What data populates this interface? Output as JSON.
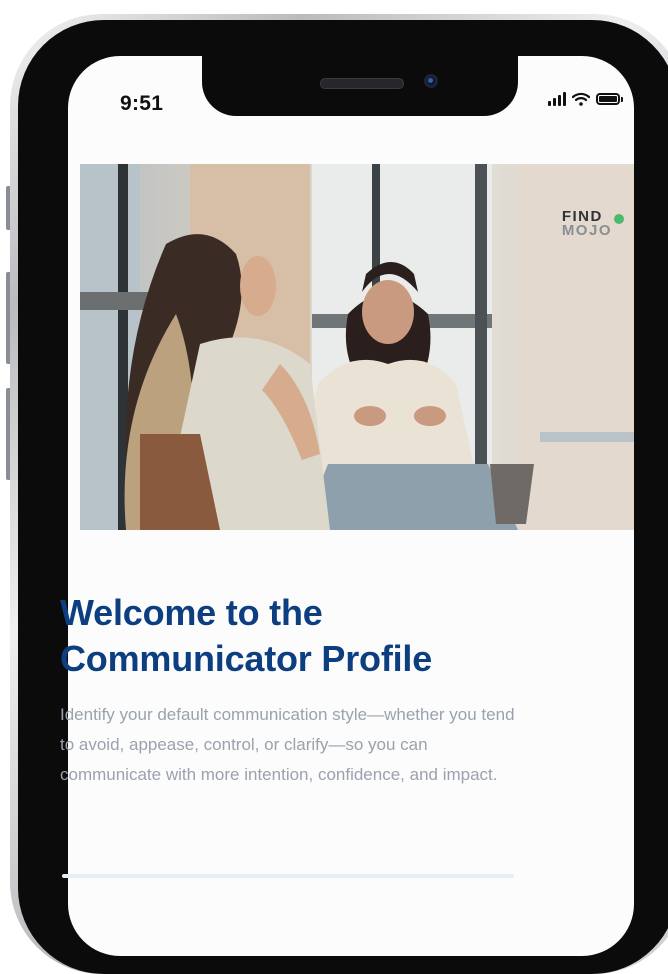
{
  "status_bar": {
    "time": "9:51"
  },
  "hero": {
    "logo_top": "FIND",
    "logo_bottom": "MOJO"
  },
  "content": {
    "title": "Welcome to the Communicator Profile",
    "description": "Identify your default communication style—whether you tend to avoid, appease, control, or clarify—so you can communicate with more intention, confidence, and impact."
  },
  "icons": [
    "signal-icon",
    "wifi-icon",
    "battery-icon",
    "speaker-icon",
    "camera-icon"
  ],
  "colors": {
    "title": "#0d3e80",
    "body_text": "#9aa2ad",
    "logo_accent": "#4fb86a"
  }
}
